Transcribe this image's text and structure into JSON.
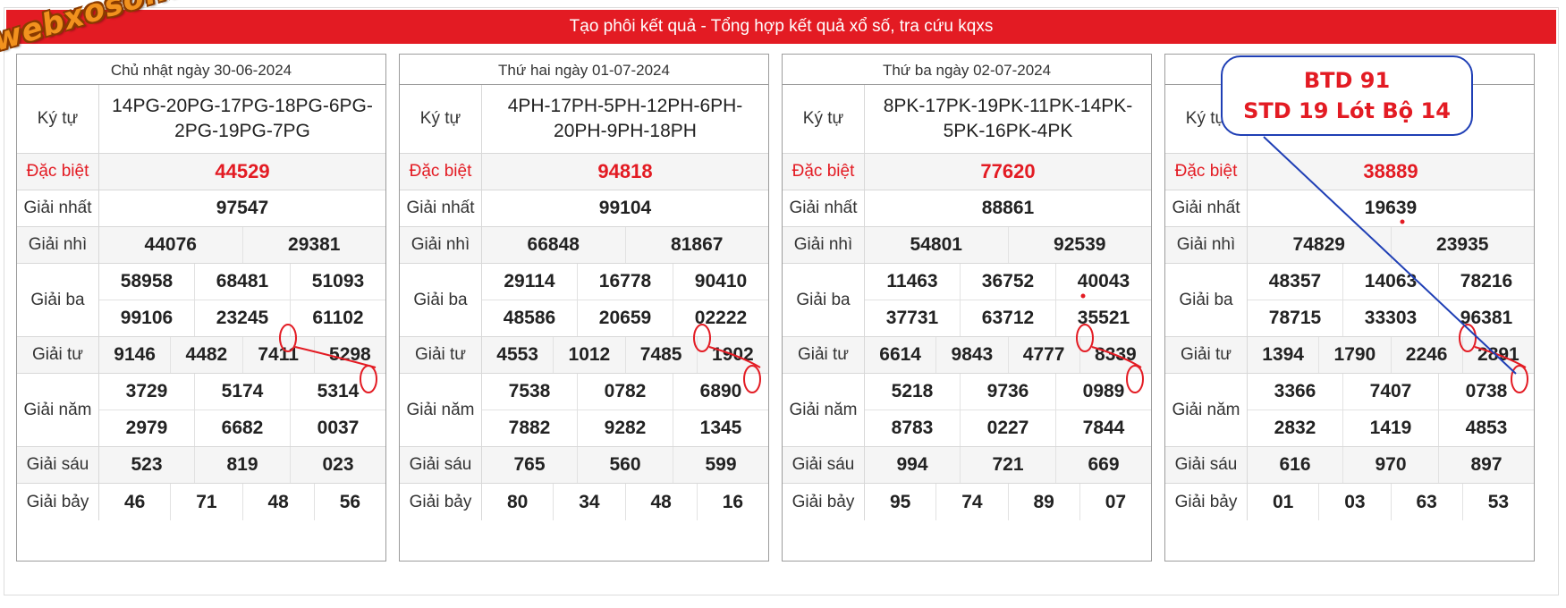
{
  "banner": {
    "title": "Tạo phôi kết quả - Tổng hợp kết quả xổ số, tra cứu kqxs"
  },
  "logo": {
    "text": "webxoso.net"
  },
  "annotation": {
    "line1": "BTD 91",
    "line2": "STD 19 Lót Bộ 14"
  },
  "labels": {
    "kytu": "Ký tự",
    "db": "Đặc biệt",
    "g1": "Giải nhất",
    "g2": "Giải nhì",
    "g3": "Giải ba",
    "g4": "Giải tư",
    "g5": "Giải năm",
    "g6": "Giải sáu",
    "g7": "Giải bảy"
  },
  "colors": {
    "accent": "#e31b23",
    "annotation_blue": "#1f3fb5"
  },
  "results": [
    {
      "date": "Chủ nhật ngày 30-06-2024",
      "kytu": "14PG-20PG-17PG-18PG-6PG-2PG-19PG-7PG",
      "db": "44529",
      "g1": "97547",
      "g2": [
        "44076",
        "29381"
      ],
      "g3": [
        "58958",
        "68481",
        "51093",
        "99106",
        "23245",
        "61102"
      ],
      "g4": [
        "9146",
        "4482",
        "7411",
        "5298"
      ],
      "g5": [
        "3729",
        "5174",
        "5314",
        "2979",
        "6682",
        "0037"
      ],
      "g6": [
        "523",
        "819",
        "023"
      ],
      "g7": [
        "46",
        "71",
        "48",
        "56"
      ]
    },
    {
      "date": "Thứ hai ngày 01-07-2024",
      "kytu": "4PH-17PH-5PH-12PH-6PH-20PH-9PH-18PH",
      "db": "94818",
      "g1": "99104",
      "g2": [
        "66848",
        "81867"
      ],
      "g3": [
        "29114",
        "16778",
        "90410",
        "48586",
        "20659",
        "02222"
      ],
      "g4": [
        "4553",
        "1012",
        "7485",
        "1902"
      ],
      "g5": [
        "7538",
        "0782",
        "6890",
        "7882",
        "9282",
        "1345"
      ],
      "g6": [
        "765",
        "560",
        "599"
      ],
      "g7": [
        "80",
        "34",
        "48",
        "16"
      ]
    },
    {
      "date": "Thứ ba ngày 02-07-2024",
      "kytu": "8PK-17PK-19PK-11PK-14PK-5PK-16PK-4PK",
      "db": "77620",
      "g1": "88861",
      "g2": [
        "54801",
        "92539"
      ],
      "g3": [
        "11463",
        "36752",
        "40043",
        "37731",
        "63712",
        "35521"
      ],
      "g4": [
        "6614",
        "9843",
        "4777",
        "8339"
      ],
      "g5": [
        "5218",
        "9736",
        "0989",
        "8783",
        "0227",
        "7844"
      ],
      "g6": [
        "994",
        "721",
        "669"
      ],
      "g7": [
        "95",
        "74",
        "89",
        "07"
      ]
    },
    {
      "date": "",
      "kytu": "",
      "db": "38889",
      "g1": "19639",
      "g2": [
        "74829",
        "23935"
      ],
      "g3": [
        "48357",
        "14063",
        "78216",
        "78715",
        "33303",
        "96381"
      ],
      "g4": [
        "1394",
        "1790",
        "2246",
        "2891"
      ],
      "g5": [
        "3366",
        "7407",
        "0738",
        "2832",
        "1419",
        "4853"
      ],
      "g6": [
        "616",
        "970",
        "897"
      ],
      "g7": [
        "01",
        "03",
        "63",
        "53"
      ]
    }
  ]
}
